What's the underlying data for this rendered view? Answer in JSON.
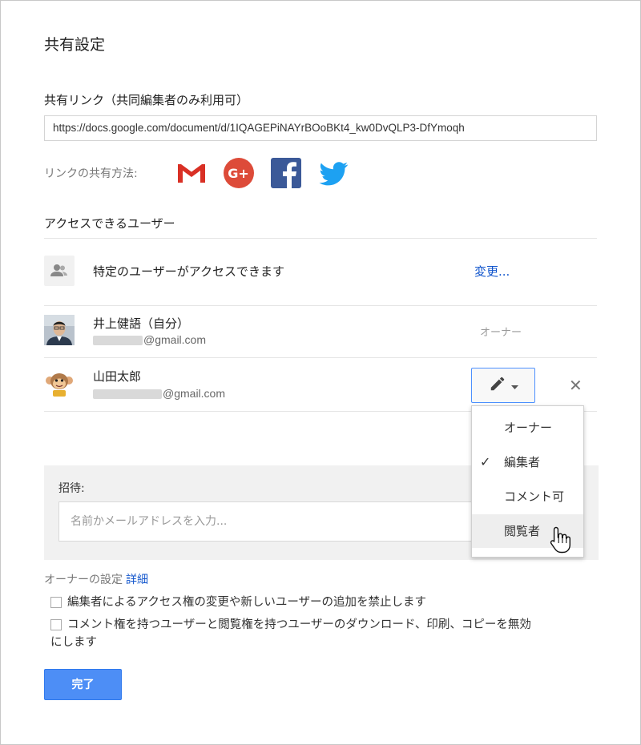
{
  "dialog": {
    "title": "共有設定"
  },
  "share_link": {
    "label": "共有リンク（共同編集者のみ利用可）",
    "url": "https://docs.google.com/document/d/1IQAGEPiNAYrBOoBKt4_kw0DvQLP3-DfYmoqh",
    "method_label": "リンクの共有方法:",
    "methods": [
      "gmail-icon",
      "google-plus-icon",
      "facebook-icon",
      "twitter-icon"
    ]
  },
  "access": {
    "label": "アクセスできるユーザー",
    "restriction_text": "特定のユーザーがアクセスできます",
    "change_link": "変更...",
    "users": [
      {
        "name": "井上健語（自分）",
        "email_suffix": "@gmail.com",
        "role": "オーナー"
      },
      {
        "name": "山田太郎",
        "email_suffix": "@gmail.com",
        "role_icon": "pencil-icon"
      }
    ]
  },
  "permission_menu": {
    "items": [
      {
        "label": "オーナー",
        "checked": false,
        "highlighted": false
      },
      {
        "label": "編集者",
        "checked": true,
        "highlighted": false
      },
      {
        "label": "コメント可",
        "checked": false,
        "highlighted": false
      },
      {
        "label": "閲覧者",
        "checked": false,
        "highlighted": true
      }
    ]
  },
  "invite": {
    "label": "招待:",
    "placeholder": "名前かメールアドレスを入力..."
  },
  "owner_settings": {
    "label": "オーナーの設定",
    "detail_link": "詳細",
    "option1": "編集者によるアクセス権の変更や新しいユーザーの追加を禁止します",
    "option2_line1": "コメント権を持つユーザーと閲覧権を持つユーザーのダウンロード、印刷、コピーを無効",
    "option2_line2": "にします"
  },
  "done_button": "完了",
  "colors": {
    "accent_blue": "#4d8ef6",
    "link_blue": "#1155cc",
    "gmail_red": "#d93025",
    "gplus_red": "#dd4b39",
    "facebook_blue": "#3b5998",
    "twitter_blue": "#1da1f2"
  }
}
